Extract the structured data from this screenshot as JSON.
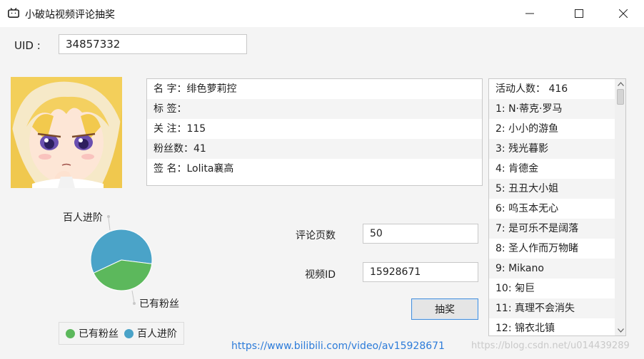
{
  "window": {
    "title": "小破站视频评论抽奖",
    "icon": "tv-icon"
  },
  "uid": {
    "label": "UID :",
    "value": "34857332"
  },
  "profile": [
    {
      "label": "名  字：",
      "value": "绯色萝莉控"
    },
    {
      "label": "标  签：",
      "value": ""
    },
    {
      "label": "关  注：",
      "value": "115"
    },
    {
      "label": "粉丝数：",
      "value": "41"
    },
    {
      "label": "签  名：",
      "value": "Lolita襄高"
    }
  ],
  "active_list": {
    "header": "活动人数：  416",
    "items": [
      "1: N·蒂克·罗马",
      "2: 小小的游鱼",
      "3: 残光暮影",
      "4: 肯德金",
      "5: 丑丑大小姐",
      "6: 呜玉本无心",
      "7: 是可乐不是阔落",
      "8: 圣人作而万物睹",
      "9: Mikano",
      "10: 匊巨",
      "11: 真理不会消失",
      "12: 锦衣北镇"
    ]
  },
  "form": {
    "pages_label": "评论页数",
    "pages_value": "50",
    "video_label": "视频ID",
    "video_value": "15928671",
    "draw_button": "抽奖"
  },
  "chart_data": {
    "type": "pie",
    "slices": [
      {
        "name": "已有粉丝",
        "value": 41,
        "color": "#5cb85c"
      },
      {
        "name": "百人进阶",
        "value": 59,
        "color": "#4aa3c8"
      }
    ],
    "labels": {
      "top": "百人进阶",
      "bottom": "已有粉丝"
    },
    "legend": [
      {
        "name": "已有粉丝",
        "color": "#5cb85c"
      },
      {
        "name": "百人进阶",
        "color": "#4aa3c8"
      }
    ]
  },
  "footer": {
    "link": "https://www.bilibili.com/video/av15928671",
    "watermark": "https://blog.csdn.net/u014439289"
  }
}
